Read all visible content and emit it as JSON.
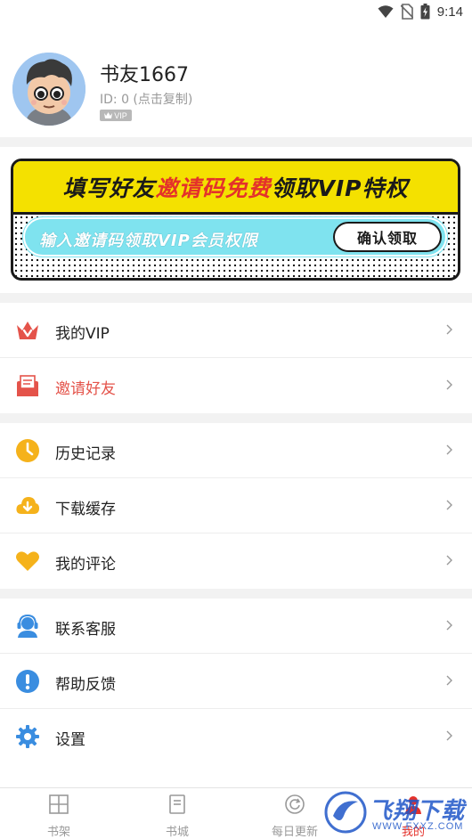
{
  "status_bar": {
    "time": "9:14"
  },
  "profile": {
    "username": "书友1667",
    "user_id": "ID: 0 (点击复制)",
    "vip_badge": "VIP"
  },
  "banner": {
    "title_part1": "填写好友",
    "title_part2": "邀请码",
    "title_part3": "免费",
    "title_part4": "领取VIP特权",
    "input_placeholder": "输入邀请码领取VIP会员权限",
    "confirm_label": "确认领取"
  },
  "menu": {
    "groups": [
      [
        {
          "label": "我的VIP",
          "icon": "vip-crown-icon",
          "color": "#e4534a"
        },
        {
          "label": "邀请好友",
          "icon": "invite-envelope-icon",
          "color": "#e4534a",
          "highlight": true
        }
      ],
      [
        {
          "label": "历史记录",
          "icon": "clock-icon",
          "color": "#f5b21b"
        },
        {
          "label": "下载缓存",
          "icon": "cloud-download-icon",
          "color": "#f5b21b"
        },
        {
          "label": "我的评论",
          "icon": "heart-icon",
          "color": "#f5b21b"
        }
      ],
      [
        {
          "label": "联系客服",
          "icon": "customer-service-icon",
          "color": "#3a8de0"
        },
        {
          "label": "帮助反馈",
          "icon": "exclamation-icon",
          "color": "#3a8de0"
        },
        {
          "label": "设置",
          "icon": "gear-icon",
          "color": "#3a8de0"
        }
      ]
    ]
  },
  "tabbar": {
    "tabs": [
      {
        "label": "书架",
        "icon": "bookshelf-icon"
      },
      {
        "label": "书城",
        "icon": "book-icon"
      },
      {
        "label": "每日更新",
        "icon": "refresh-icon"
      },
      {
        "label": "我的",
        "icon": "profile-icon",
        "active": true
      }
    ]
  },
  "watermark": {
    "text": "飞翔下载",
    "sub": "WWW.FXXZ.COM"
  },
  "colors": {
    "accent": "#e4312b",
    "banner_yellow": "#f4e100",
    "banner_cyan": "#7fe3ef"
  }
}
